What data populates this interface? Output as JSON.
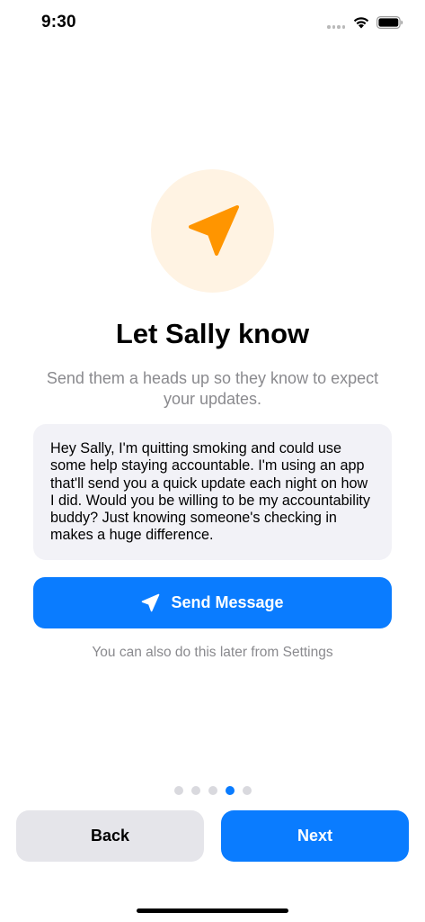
{
  "status_bar": {
    "time": "9:30"
  },
  "hero": {
    "icon": "paperplane-fill-icon",
    "icon_color": "#ff9500",
    "circle_color": "#fff3e3"
  },
  "title": "Let Sally know",
  "subtitle": "Send them a heads up so they know to expect your updates.",
  "message": {
    "text": "Hey Sally, I'm quitting smoking and could use some help staying accountable. I'm using an app that'll send you a quick update each night on how I did. Would you be willing to be my accountability buddy? Just knowing someone's checking in makes a huge difference."
  },
  "send_button": {
    "label": "Send Message",
    "icon": "paperplane-icon"
  },
  "hint": "You can also do this later from Settings",
  "pagination": {
    "total": 5,
    "current": 4
  },
  "buttons": {
    "back": "Back",
    "next": "Next"
  },
  "colors": {
    "accent": "#0a7cff",
    "orange": "#ff9500",
    "secondary_text": "#8a8a8e",
    "card_background": "#f2f2f7"
  }
}
